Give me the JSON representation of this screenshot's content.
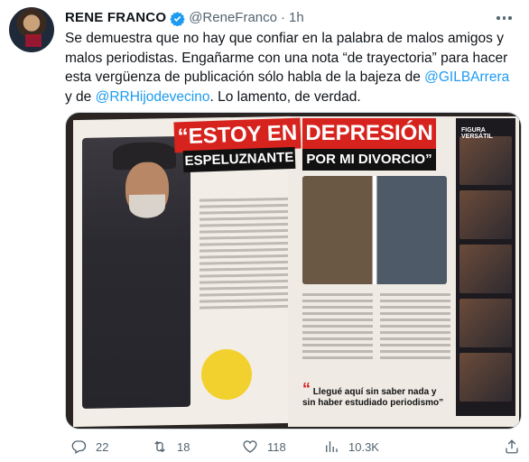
{
  "tweet": {
    "author_name": "RENE FRANCO",
    "handle": "@ReneFranco",
    "separator": "·",
    "time": "1h",
    "text_parts": {
      "p1": "Se demuestra que no hay que confiar en la palabra de malos amigos y malos periodistas. Engañarme con una nota “de trayectoria” para hacer esta vergüenza de publicación sólo habla de la bajeza de ",
      "mention1": "@GILBArrera",
      "p2": " y de ",
      "mention2": "@RRHijodevecino",
      "p3": ". Lo lamento, de verdad."
    }
  },
  "media": {
    "headline_left_1": "“ESTOY EN",
    "headline_left_2": "ESPELUZNANTE",
    "headline_right_1": "DEPRESIÓN",
    "headline_right_2": "POR MI DIVORCIO”",
    "sidebar_label": "FIGURA VERSÁTIL",
    "quote": "Llegué aquí sin saber nada y sin haber estudiado periodismo”"
  },
  "actions": {
    "replies": "22",
    "retweets": "18",
    "likes": "118",
    "views": "10.3K"
  },
  "colors": {
    "accent": "#1d9bf0",
    "secondary_text": "#536471",
    "magazine_red": "#d7231e"
  },
  "icons": [
    "verified-badge-icon",
    "more-icon",
    "reply-icon",
    "retweet-icon",
    "like-icon",
    "views-icon",
    "share-icon"
  ]
}
